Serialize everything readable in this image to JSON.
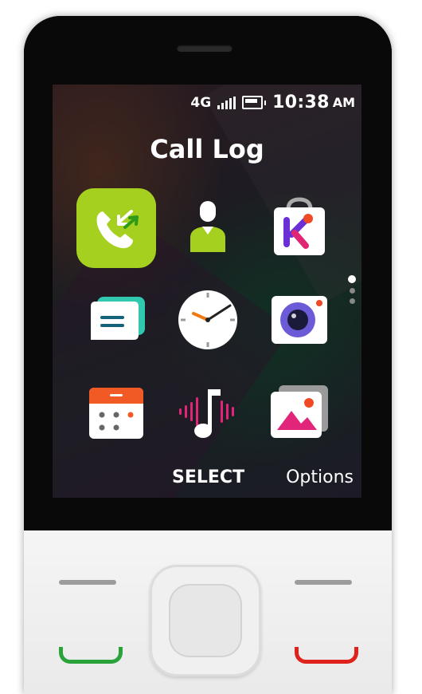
{
  "status": {
    "network": "4G",
    "time": "10:38",
    "ampm": "AM"
  },
  "screen_title": "Call Log",
  "apps": [
    {
      "name": "Call Log",
      "icon": "call-log-icon",
      "selected": true
    },
    {
      "name": "Contacts",
      "icon": "contacts-icon"
    },
    {
      "name": "Store",
      "icon": "store-icon"
    },
    {
      "name": "Messages",
      "icon": "messages-icon"
    },
    {
      "name": "Clock",
      "icon": "clock-icon"
    },
    {
      "name": "Camera",
      "icon": "camera-icon"
    },
    {
      "name": "Calendar",
      "icon": "calendar-icon"
    },
    {
      "name": "Music",
      "icon": "music-icon"
    },
    {
      "name": "Gallery",
      "icon": "gallery-icon"
    }
  ],
  "softkeys": {
    "center": "SELECT",
    "right": "Options"
  },
  "colors": {
    "selected_tile": "#a6d01f",
    "call_key": "#2aa33a",
    "end_key": "#e0221d"
  }
}
